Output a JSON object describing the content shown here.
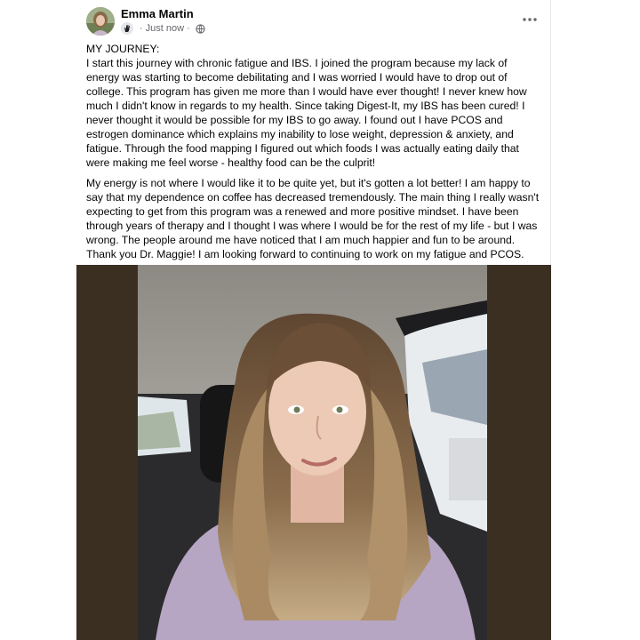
{
  "post": {
    "author": "Emma Martin",
    "timestamp": "Just now",
    "separator": "·",
    "more_icon": "more-horizontal-icon",
    "privacy_icon": "globe-icon",
    "paragraphs": [
      "MY JOURNEY:\nI start this journey with chronic fatigue and IBS. I joined the program because my lack of energy was starting to become debilitating and I was worried I would have to drop out of college. This program has given me more than I would have ever thought! I never knew how much I didn't know in regards to my health. Since taking Digest-It, my IBS has been cured! I never thought it would be possible for my IBS to go away. I found out I have PCOS and estrogen dominance which explains my inability to lose weight, depression & anxiety, and fatigue. Through the food mapping I figured out which foods I was actually eating daily that were making me feel worse - healthy food can be the culprit!",
      "My energy is not where I would like it to be quite yet, but it's gotten a lot better! I am happy to say that my dependence on coffee has decreased tremendously. The main thing I really wasn't expecting to get from this program was a renewed and more positive mindset. I have been through years of therapy and I thought I was where I would be for the rest of my life - but I was wrong. The people around me have noticed that I am much happier and fun to be around. Thank you Dr. Maggie! I am looking forward to continuing to work on my fatigue and PCOS."
    ]
  }
}
